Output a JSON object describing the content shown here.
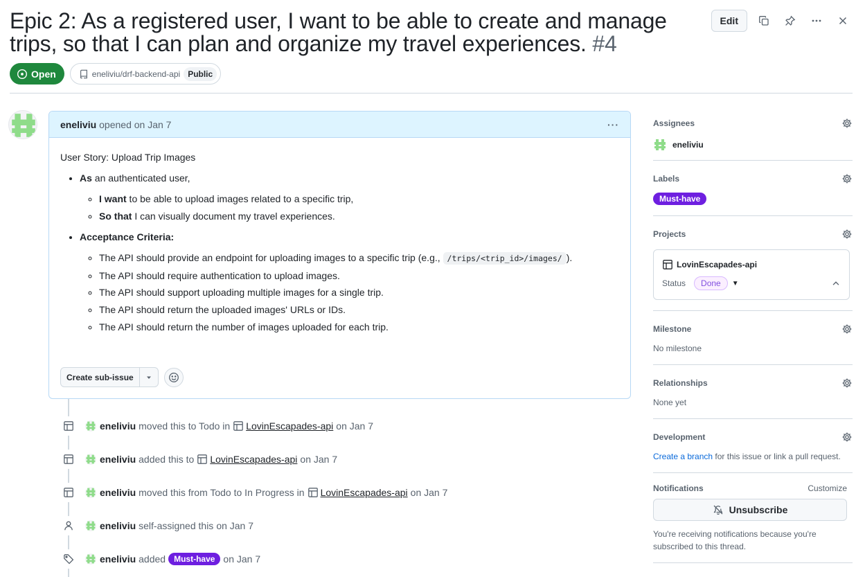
{
  "issue": {
    "title": "Epic 2: As a registered user, I want to be able to create and manage trips, so that I can plan and organize my travel experiences.",
    "number": "#4",
    "state": "Open",
    "repo": "eneliviu/drf-backend-api",
    "visibility": "Public"
  },
  "header_actions": {
    "edit_label": "Edit"
  },
  "comment": {
    "author": "eneliviu",
    "meta": "opened on Jan 7",
    "kebab": "···",
    "heading": "User Story: Upload Trip Images",
    "as_bold": "As",
    "as_rest": " an authenticated user,",
    "want_bold": "I want",
    "want_rest": " to be able to upload images related to a specific trip,",
    "sothat_bold": "So that",
    "sothat_rest": " I can visually document my travel experiences.",
    "acceptance_title": "Acceptance Criteria:",
    "criteria1_pre": "The API should provide an endpoint for uploading images to a specific trip (e.g., ",
    "criteria1_code": "/trips/<trip_id>/images/",
    "criteria1_post": ").",
    "criteria": [
      "The API should require authentication to upload images.",
      "The API should support uploading multiple images for a single trip.",
      "The API should return the uploaded images' URLs or IDs.",
      "The API should return the number of images uploaded for each trip."
    ],
    "create_subissue_label": "Create sub-issue"
  },
  "timeline": [
    {
      "user": "eneliviu",
      "pre": "moved this to Todo in",
      "project": "LovinEscapades-api",
      "post": "on Jan 7",
      "icon": "table-icon"
    },
    {
      "user": "eneliviu",
      "pre": "added this to",
      "project": "LovinEscapades-api",
      "post": "on Jan 7",
      "icon": "table-icon"
    },
    {
      "user": "eneliviu",
      "pre": "moved this from Todo to In Progress in",
      "project": "LovinEscapades-api",
      "post": "on Jan 7",
      "icon": "table-icon"
    },
    {
      "user": "eneliviu",
      "pre": "self-assigned this",
      "post": "on Jan 7",
      "icon": "person-icon"
    },
    {
      "user": "eneliviu",
      "pre": "added",
      "label": "Must-have",
      "post": "on Jan 7",
      "icon": "tag-icon"
    }
  ],
  "sidebar": {
    "assignees_title": "Assignees",
    "assignee": "eneliviu",
    "labels_title": "Labels",
    "label": "Must-have",
    "projects_title": "Projects",
    "project_name": "LovinEscapades-api",
    "status_label": "Status",
    "status_value": "Done",
    "milestone_title": "Milestone",
    "milestone_value": "No milestone",
    "relationships_title": "Relationships",
    "relationships_value": "None yet",
    "development_title": "Development",
    "development_link": "Create a branch",
    "development_rest": " for this issue or link a pull request.",
    "notifications_title": "Notifications",
    "customize": "Customize",
    "unsubscribe": "Unsubscribe",
    "notify_text": "You're receiving notifications because you're subscribed to this thread."
  },
  "colors": {
    "open_green": "#1f883d",
    "label_purple": "#6e1fe0",
    "comment_header": "#ddf4ff",
    "link_blue": "#0969da"
  }
}
